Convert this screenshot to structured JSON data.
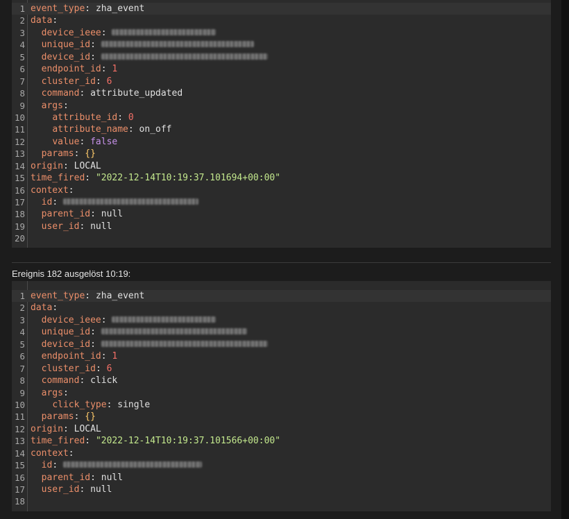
{
  "event2_title": "Ereignis 182 ausgelöst 10:19:",
  "event1": {
    "lines": [
      {
        "n": "1",
        "parts": [
          [
            "k",
            "event_type"
          ],
          [
            "p",
            ": "
          ],
          [
            "s",
            "zha_event"
          ]
        ]
      },
      {
        "n": "2",
        "parts": [
          [
            "k",
            "data"
          ],
          [
            "p",
            ":"
          ]
        ]
      },
      {
        "n": "3",
        "parts": [
          [
            "p",
            "  "
          ],
          [
            "k",
            "device_ieee"
          ],
          [
            "p",
            ": "
          ],
          [
            "blur",
            "150"
          ]
        ]
      },
      {
        "n": "4",
        "parts": [
          [
            "p",
            "  "
          ],
          [
            "k",
            "unique_id"
          ],
          [
            "p",
            ": "
          ],
          [
            "blur",
            "220"
          ]
        ]
      },
      {
        "n": "5",
        "parts": [
          [
            "p",
            "  "
          ],
          [
            "k",
            "device_id"
          ],
          [
            "p",
            ": "
          ],
          [
            "blur",
            "240"
          ]
        ]
      },
      {
        "n": "6",
        "parts": [
          [
            "p",
            "  "
          ],
          [
            "k",
            "endpoint_id"
          ],
          [
            "p",
            ": "
          ],
          [
            "n",
            "1"
          ]
        ]
      },
      {
        "n": "7",
        "parts": [
          [
            "p",
            "  "
          ],
          [
            "k",
            "cluster_id"
          ],
          [
            "p",
            ": "
          ],
          [
            "n",
            "6"
          ]
        ]
      },
      {
        "n": "8",
        "parts": [
          [
            "p",
            "  "
          ],
          [
            "k",
            "command"
          ],
          [
            "p",
            ": "
          ],
          [
            "s",
            "attribute_updated"
          ]
        ]
      },
      {
        "n": "9",
        "parts": [
          [
            "p",
            "  "
          ],
          [
            "k",
            "args"
          ],
          [
            "p",
            ":"
          ]
        ]
      },
      {
        "n": "10",
        "parts": [
          [
            "p",
            "    "
          ],
          [
            "k",
            "attribute_id"
          ],
          [
            "p",
            ": "
          ],
          [
            "n",
            "0"
          ]
        ]
      },
      {
        "n": "11",
        "parts": [
          [
            "p",
            "    "
          ],
          [
            "k",
            "attribute_name"
          ],
          [
            "p",
            ": "
          ],
          [
            "s",
            "on_off"
          ]
        ]
      },
      {
        "n": "12",
        "parts": [
          [
            "p",
            "    "
          ],
          [
            "k",
            "value"
          ],
          [
            "p",
            ": "
          ],
          [
            "b",
            "false"
          ]
        ]
      },
      {
        "n": "13",
        "parts": [
          [
            "p",
            "  "
          ],
          [
            "k",
            "params"
          ],
          [
            "p",
            ": "
          ],
          [
            "o",
            "{}"
          ]
        ]
      },
      {
        "n": "14",
        "parts": [
          [
            "k",
            "origin"
          ],
          [
            "p",
            ": "
          ],
          [
            "s",
            "LOCAL"
          ]
        ]
      },
      {
        "n": "15",
        "parts": [
          [
            "k",
            "time_fired"
          ],
          [
            "p",
            ": "
          ],
          [
            "str",
            "\"2022-12-14T10:19:37.101694+00:00\""
          ]
        ]
      },
      {
        "n": "16",
        "parts": [
          [
            "k",
            "context"
          ],
          [
            "p",
            ":"
          ]
        ]
      },
      {
        "n": "17",
        "parts": [
          [
            "p",
            "  "
          ],
          [
            "k",
            "id"
          ],
          [
            "p",
            ": "
          ],
          [
            "blur",
            "195"
          ]
        ]
      },
      {
        "n": "18",
        "parts": [
          [
            "p",
            "  "
          ],
          [
            "k",
            "parent_id"
          ],
          [
            "p",
            ": "
          ],
          [
            "s",
            "null"
          ]
        ]
      },
      {
        "n": "19",
        "parts": [
          [
            "p",
            "  "
          ],
          [
            "k",
            "user_id"
          ],
          [
            "p",
            ": "
          ],
          [
            "s",
            "null"
          ]
        ]
      },
      {
        "n": "20",
        "parts": []
      }
    ]
  },
  "event2": {
    "lines": [
      {
        "n": "1",
        "parts": [
          [
            "k",
            "event_type"
          ],
          [
            "p",
            ": "
          ],
          [
            "s",
            "zha_event"
          ]
        ]
      },
      {
        "n": "2",
        "parts": [
          [
            "k",
            "data"
          ],
          [
            "p",
            ":"
          ]
        ]
      },
      {
        "n": "3",
        "parts": [
          [
            "p",
            "  "
          ],
          [
            "k",
            "device_ieee"
          ],
          [
            "p",
            ": "
          ],
          [
            "blur",
            "150"
          ]
        ]
      },
      {
        "n": "4",
        "parts": [
          [
            "p",
            "  "
          ],
          [
            "k",
            "unique_id"
          ],
          [
            "p",
            ": "
          ],
          [
            "blur",
            "210"
          ]
        ]
      },
      {
        "n": "5",
        "parts": [
          [
            "p",
            "  "
          ],
          [
            "k",
            "device_id"
          ],
          [
            "p",
            ": "
          ],
          [
            "blur",
            "240"
          ]
        ]
      },
      {
        "n": "6",
        "parts": [
          [
            "p",
            "  "
          ],
          [
            "k",
            "endpoint_id"
          ],
          [
            "p",
            ": "
          ],
          [
            "n",
            "1"
          ]
        ]
      },
      {
        "n": "7",
        "parts": [
          [
            "p",
            "  "
          ],
          [
            "k",
            "cluster_id"
          ],
          [
            "p",
            ": "
          ],
          [
            "n",
            "6"
          ]
        ]
      },
      {
        "n": "8",
        "parts": [
          [
            "p",
            "  "
          ],
          [
            "k",
            "command"
          ],
          [
            "p",
            ": "
          ],
          [
            "s",
            "click"
          ]
        ]
      },
      {
        "n": "9",
        "parts": [
          [
            "p",
            "  "
          ],
          [
            "k",
            "args"
          ],
          [
            "p",
            ":"
          ]
        ]
      },
      {
        "n": "10",
        "parts": [
          [
            "p",
            "    "
          ],
          [
            "k",
            "click_type"
          ],
          [
            "p",
            ": "
          ],
          [
            "s",
            "single"
          ]
        ]
      },
      {
        "n": "11",
        "parts": [
          [
            "p",
            "  "
          ],
          [
            "k",
            "params"
          ],
          [
            "p",
            ": "
          ],
          [
            "o",
            "{}"
          ]
        ]
      },
      {
        "n": "12",
        "parts": [
          [
            "k",
            "origin"
          ],
          [
            "p",
            ": "
          ],
          [
            "s",
            "LOCAL"
          ]
        ]
      },
      {
        "n": "13",
        "parts": [
          [
            "k",
            "time_fired"
          ],
          [
            "p",
            ": "
          ],
          [
            "str",
            "\"2022-12-14T10:19:37.101566+00:00\""
          ]
        ]
      },
      {
        "n": "14",
        "parts": [
          [
            "k",
            "context"
          ],
          [
            "p",
            ":"
          ]
        ]
      },
      {
        "n": "15",
        "parts": [
          [
            "p",
            "  "
          ],
          [
            "k",
            "id"
          ],
          [
            "p",
            ": "
          ],
          [
            "blur",
            "200"
          ]
        ]
      },
      {
        "n": "16",
        "parts": [
          [
            "p",
            "  "
          ],
          [
            "k",
            "parent_id"
          ],
          [
            "p",
            ": "
          ],
          [
            "s",
            "null"
          ]
        ]
      },
      {
        "n": "17",
        "parts": [
          [
            "p",
            "  "
          ],
          [
            "k",
            "user_id"
          ],
          [
            "p",
            ": "
          ],
          [
            "s",
            "null"
          ]
        ]
      },
      {
        "n": "18",
        "parts": []
      }
    ]
  }
}
